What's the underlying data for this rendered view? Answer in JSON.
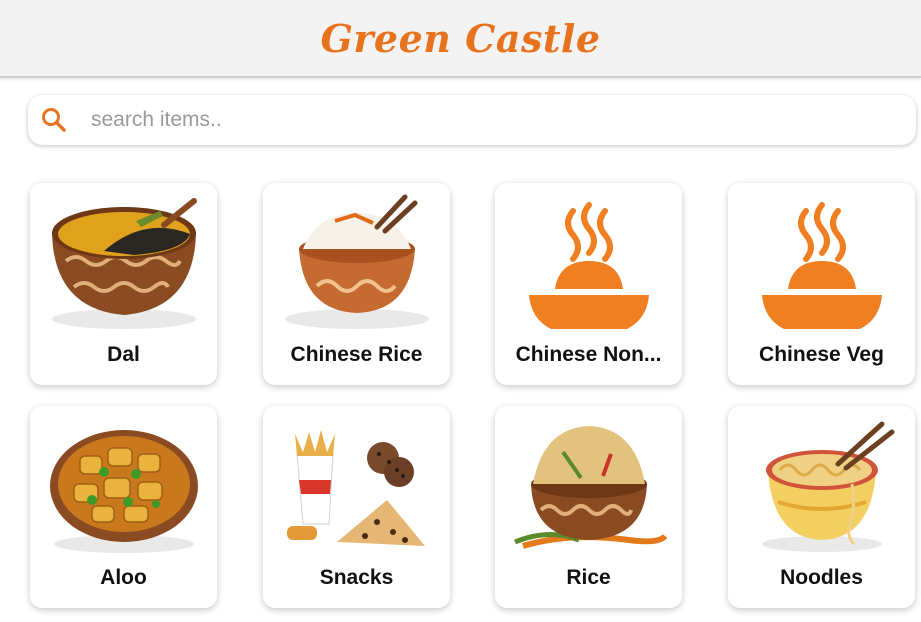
{
  "header": {
    "title": "Green Castle"
  },
  "search": {
    "placeholder": "search items.."
  },
  "colors": {
    "accent": "#e8731f",
    "icon_orange": "#f07f22"
  },
  "categories": [
    {
      "label": "Dal",
      "icon": "dal-bowl-icon"
    },
    {
      "label": "Chinese Rice",
      "icon": "rice-bowl-icon"
    },
    {
      "label": "Chinese Non...",
      "icon": "steaming-bowl-icon"
    },
    {
      "label": "Chinese Veg",
      "icon": "steaming-bowl-icon"
    },
    {
      "label": "Aloo",
      "icon": "potato-curry-icon"
    },
    {
      "label": "Snacks",
      "icon": "snacks-icon"
    },
    {
      "label": "Rice",
      "icon": "fried-rice-icon"
    },
    {
      "label": "Noodles",
      "icon": "noodles-bowl-icon"
    }
  ]
}
